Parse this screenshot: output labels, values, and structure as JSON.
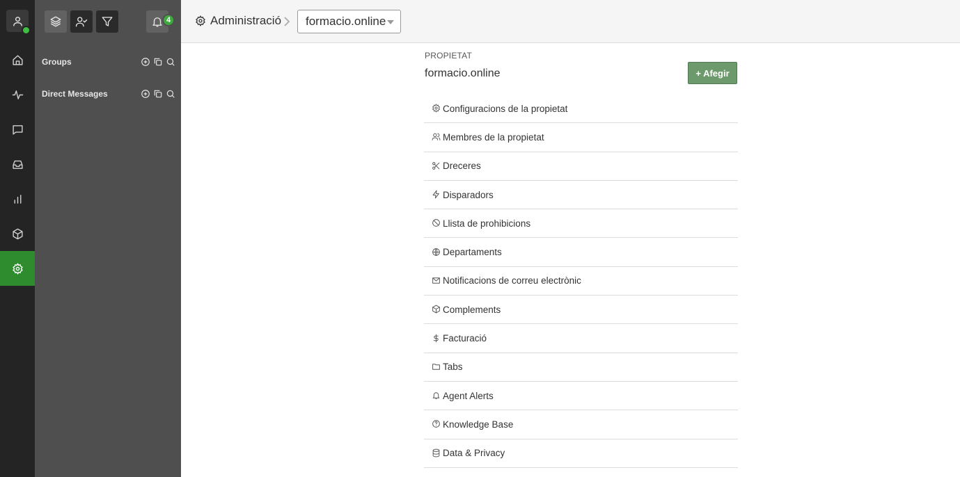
{
  "colors": {
    "accent": "#2e8b2e",
    "add_button": "#6d9a6d",
    "rail": "#242424",
    "panel": "#4f4f4f"
  },
  "rail": {
    "items": [
      {
        "icon": "user-icon"
      },
      {
        "icon": "home-icon"
      },
      {
        "icon": "activity-icon"
      },
      {
        "icon": "chat-icon"
      },
      {
        "icon": "inbox-icon"
      },
      {
        "icon": "bar-chart-icon"
      },
      {
        "icon": "box-icon"
      },
      {
        "icon": "gear-icon",
        "active": true
      }
    ]
  },
  "panel": {
    "buttons": [
      {
        "icon": "layers-icon"
      },
      {
        "icon": "user-check-icon"
      },
      {
        "icon": "filter-icon"
      }
    ],
    "notifications_count": "4",
    "sections": [
      {
        "label": "Groups"
      },
      {
        "label": "Direct Messages"
      }
    ]
  },
  "header": {
    "breadcrumb": "Administració",
    "property_select": "formacio.online"
  },
  "main": {
    "kicker": "PROPIETAT",
    "property_name": "formacio.online",
    "add_button": "+ Afegir",
    "menu": [
      {
        "label": "Configuracions de la propietat",
        "icon": "gear-icon"
      },
      {
        "label": "Membres de la propietat",
        "icon": "users-icon"
      },
      {
        "label": "Dreceres",
        "icon": "scissors-icon"
      },
      {
        "label": "Disparadors",
        "icon": "lightning-icon"
      },
      {
        "label": "Llista de prohibicions",
        "icon": "ban-icon"
      },
      {
        "label": "Departaments",
        "icon": "globe-icon"
      },
      {
        "label": "Notificacions de correu electrònic",
        "icon": "mail-icon"
      },
      {
        "label": "Complements",
        "icon": "box-icon"
      },
      {
        "label": "Facturació",
        "icon": "dollar-icon"
      },
      {
        "label": "Tabs",
        "icon": "folder-icon"
      },
      {
        "label": "Agent Alerts",
        "icon": "bell-icon"
      },
      {
        "label": "Knowledge Base",
        "icon": "help-circle-icon"
      },
      {
        "label": "Data & Privacy",
        "icon": "database-icon"
      }
    ]
  }
}
